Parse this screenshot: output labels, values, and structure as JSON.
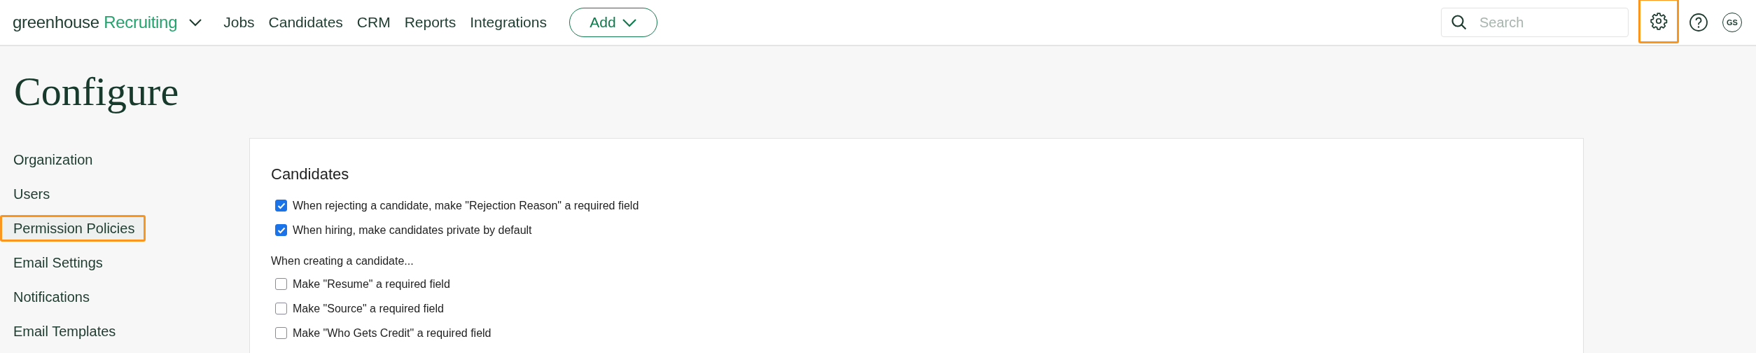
{
  "top_bar": {
    "brand": "greenhouse",
    "product": "Recruiting",
    "nav": [
      {
        "label": "Jobs"
      },
      {
        "label": "Candidates"
      },
      {
        "label": "CRM"
      },
      {
        "label": "Reports"
      },
      {
        "label": "Integrations"
      }
    ],
    "add_button": "Add",
    "search": {
      "placeholder": "Search"
    },
    "settings_highlighted": true,
    "avatar": "GS"
  },
  "page_title": "Configure",
  "sidebar": {
    "items": [
      {
        "label": "Organization",
        "highlighted": false
      },
      {
        "label": "Users",
        "highlighted": false
      },
      {
        "label": "Permission Policies",
        "highlighted": true
      },
      {
        "label": "Email Settings",
        "highlighted": false
      },
      {
        "label": "Notifications",
        "highlighted": false
      },
      {
        "label": "Email Templates",
        "highlighted": false
      }
    ]
  },
  "panel": {
    "title": "Candidates",
    "items": [
      {
        "kind": "checkbox",
        "label": "When rejecting a candidate, make \"Rejection Reason\" a required field",
        "checked": true
      },
      {
        "kind": "checkbox",
        "label": "When hiring, make candidates private by default",
        "checked": true
      },
      {
        "kind": "heading",
        "label": "When creating a candidate..."
      },
      {
        "kind": "checkbox",
        "label": "Make \"Resume\" a required field",
        "checked": false
      },
      {
        "kind": "checkbox",
        "label": "Make \"Source\" a required field",
        "checked": false
      },
      {
        "kind": "checkbox",
        "label": "Make \"Who Gets Credit\" a required field",
        "checked": false
      }
    ]
  }
}
